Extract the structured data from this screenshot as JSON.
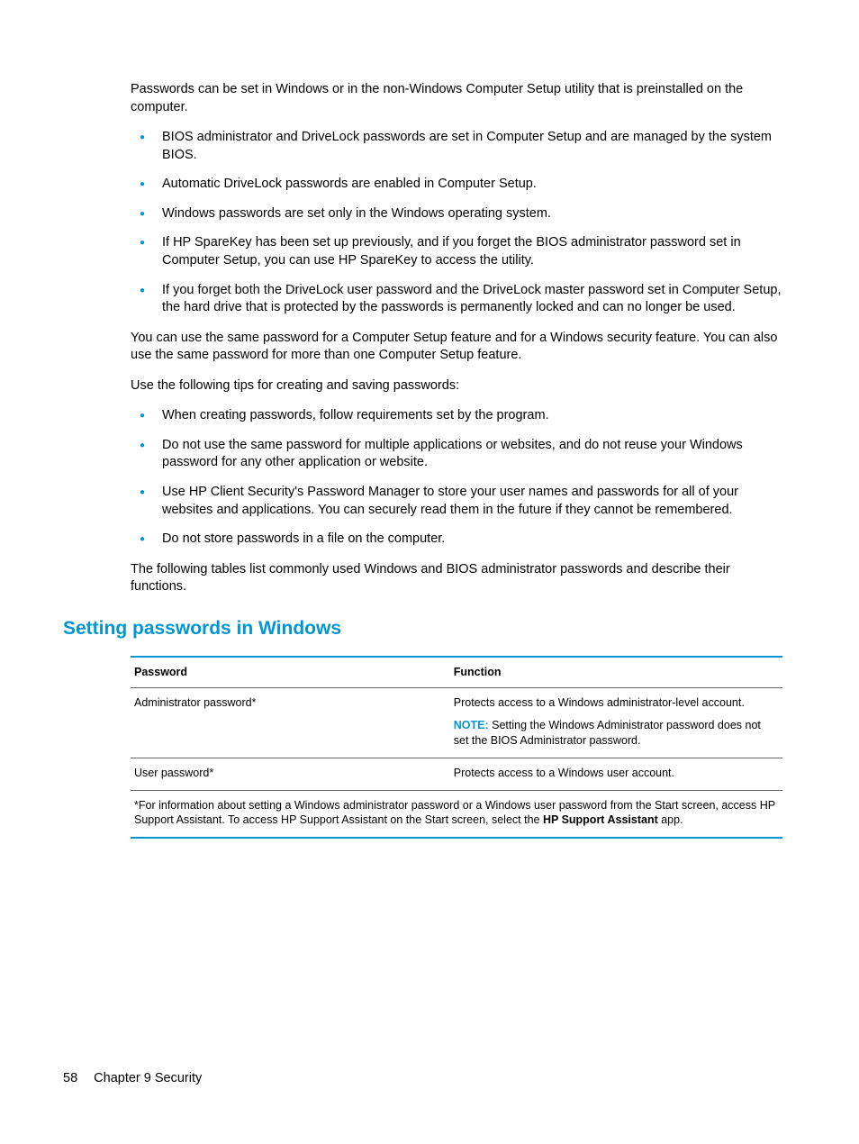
{
  "paragraphs": {
    "intro": "Passwords can be set in Windows or in the non-Windows Computer Setup utility that is preinstalled on the computer.",
    "same_password": "You can use the same password for a Computer Setup feature and for a Windows security feature. You can also use the same password for more than one Computer Setup feature.",
    "tips_intro": "Use the following tips for creating and saving passwords:",
    "tables_intro": "The following tables list commonly used Windows and BIOS administrator passwords and describe their functions."
  },
  "bullets1": [
    "BIOS administrator and DriveLock passwords are set in Computer Setup and are managed by the system BIOS.",
    "Automatic DriveLock passwords are enabled in Computer Setup.",
    "Windows passwords are set only in the Windows operating system.",
    "If HP SpareKey has been set up previously, and if you forget the BIOS administrator password set in Computer Setup, you can use HP SpareKey to access the utility.",
    "If you forget both the DriveLock user password and the DriveLock master password set in Computer Setup, the hard drive that is protected by the passwords is permanently locked and can no longer be used."
  ],
  "bullets2": [
    "When creating passwords, follow requirements set by the program.",
    "Do not use the same password for multiple applications or websites, and do not reuse your Windows password for any other application or website.",
    "Use HP Client Security's Password Manager to store your user names and passwords for all of your websites and applications. You can securely read them in the future if they cannot be remembered.",
    "Do not store passwords in a file on the computer."
  ],
  "section_heading": "Setting passwords in Windows",
  "table": {
    "headers": {
      "col1": "Password",
      "col2": "Function"
    },
    "rows": [
      {
        "password": "Administrator password*",
        "function": "Protects access to a Windows administrator-level account.",
        "note_label": "NOTE:",
        "note_text": "Setting the Windows Administrator password does not set the BIOS Administrator password."
      },
      {
        "password": "User password*",
        "function": "Protects access to a Windows user account."
      }
    ],
    "footnote_pre": "*For information about setting a Windows administrator password or a Windows user password from the Start screen, access HP Support Assistant. To access HP Support Assistant on the Start screen, select the ",
    "footnote_bold": "HP Support Assistant",
    "footnote_post": " app."
  },
  "footer": {
    "page": "58",
    "chapter": "Chapter 9   Security"
  }
}
